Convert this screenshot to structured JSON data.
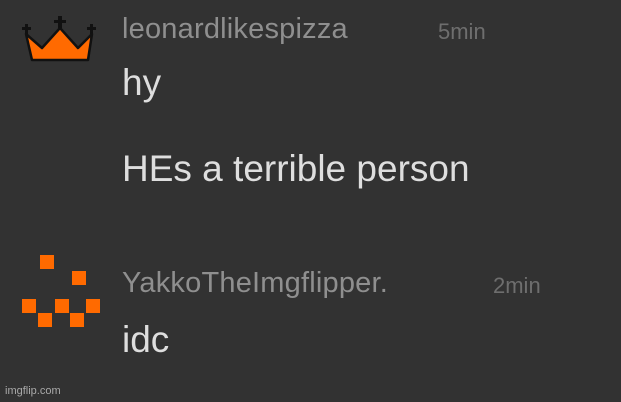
{
  "colors": {
    "background": "#323232",
    "username": "#8f8f8f",
    "timestamp": "#6e6e6e",
    "message": "#dedede",
    "badge_orange": "#ff6a00",
    "crown_cross": "#111111"
  },
  "comments": [
    {
      "avatar_icon": "crown-icon",
      "username": "leonardlikespizza",
      "time": "5min",
      "messages": [
        "hy",
        "HEs a terrible person"
      ]
    },
    {
      "avatar_icon": "pixel-smile-icon",
      "username": "YakkoTheImgflipper.",
      "time": "2min",
      "messages": [
        "idc"
      ]
    }
  ],
  "watermark": "imgflip.com"
}
